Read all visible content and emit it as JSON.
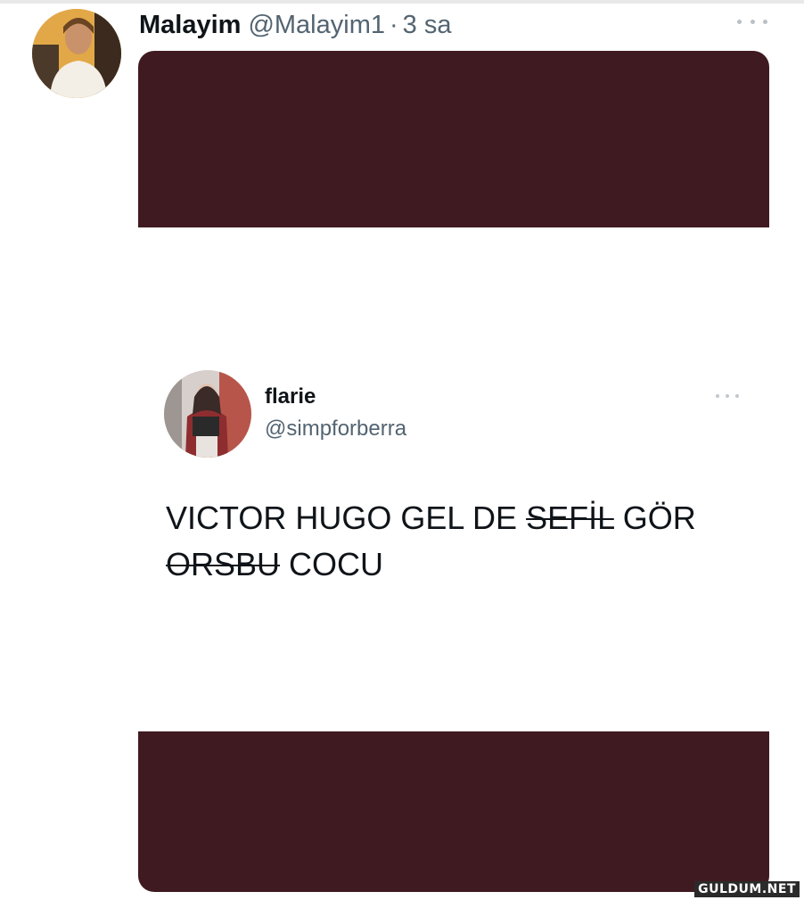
{
  "tweet": {
    "display_name": "Malayim",
    "handle": "@Malayim1",
    "separator": "·",
    "time": "3 sa",
    "more_icon": "more-horizontal-icon"
  },
  "embedded_tweet": {
    "display_name": "flarie",
    "handle": "@simpforberra",
    "more_icon": "more-horizontal-icon",
    "text_parts": [
      "VICTOR HUGO GEL DE ",
      "SEFİL",
      " GÖR ",
      "ORSBU",
      " COCU"
    ]
  },
  "watermark": "GULDUM.NET",
  "colors": {
    "media_background": "#3f1b21",
    "secondary_text": "#536471",
    "primary_text": "#0f1419"
  }
}
